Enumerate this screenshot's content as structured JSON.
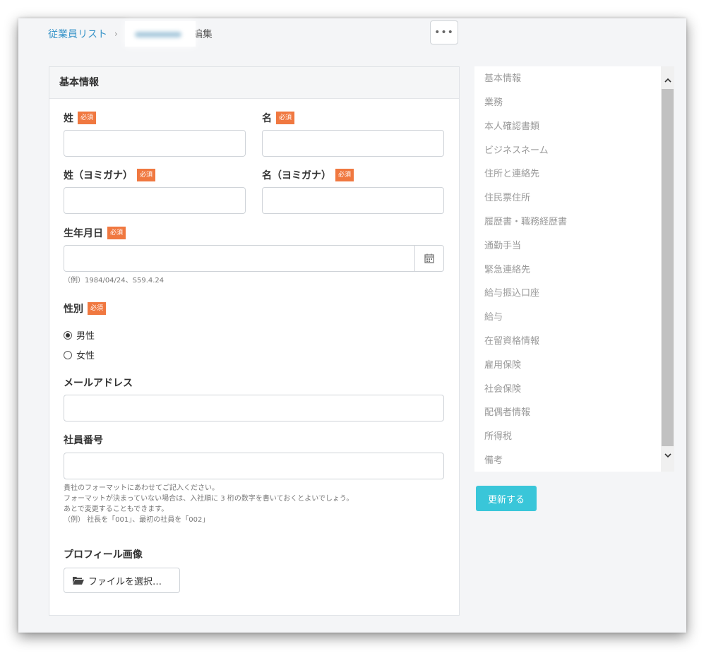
{
  "breadcrumb": {
    "list_link": "従業員リスト",
    "separator": "›",
    "current": "編集"
  },
  "more_button": {
    "label": "•••"
  },
  "section": {
    "title": "基本情報"
  },
  "form": {
    "required_badge": "必須",
    "last_name_label": "姓",
    "first_name_label": "名",
    "last_name_kana_label": "姓（ヨミガナ）",
    "first_name_kana_label": "名（ヨミガナ）",
    "birthdate_label": "生年月日",
    "birthdate_hint": "（例）1984/04/24、S59.4.24",
    "gender_label": "性別",
    "gender_options": {
      "male": "男性",
      "female": "女性"
    },
    "gender_selected": "男性",
    "email_label": "メールアドレス",
    "employee_no_label": "社員番号",
    "employee_no_hint": {
      "line1": "貴社のフォーマットにあわせてご記入ください。",
      "line2": "フォーマットが決まっていない場合は、入社順に 3 桁の数字を書いておくとよいでしょう。",
      "line3": "あとで変更することもできます。",
      "line4": "（例） 社長を「001」、最初の社員を「002」"
    },
    "profile_image_label": "プロフィール画像",
    "file_button_label": "ファイルを選択…"
  },
  "nav": {
    "items": [
      "基本情報",
      "業務",
      "本人確認書類",
      "ビジネスネーム",
      "住所と連絡先",
      "住民票住所",
      "履歴書・職務経歴書",
      "通勤手当",
      "緊急連絡先",
      "給与振込口座",
      "給与",
      "在留資格情報",
      "雇用保険",
      "社会保険",
      "配偶者情報",
      "所得税",
      "備考"
    ]
  },
  "update_button": {
    "label": "更新する"
  },
  "colors": {
    "accent": "#39c6d9",
    "required": "#f07840",
    "link": "#3a95c9"
  },
  "icons": {
    "calendar": "calendar-icon",
    "folder": "folder-open-icon",
    "scroll_up": "chevron-up-icon",
    "scroll_down": "chevron-down-icon"
  }
}
